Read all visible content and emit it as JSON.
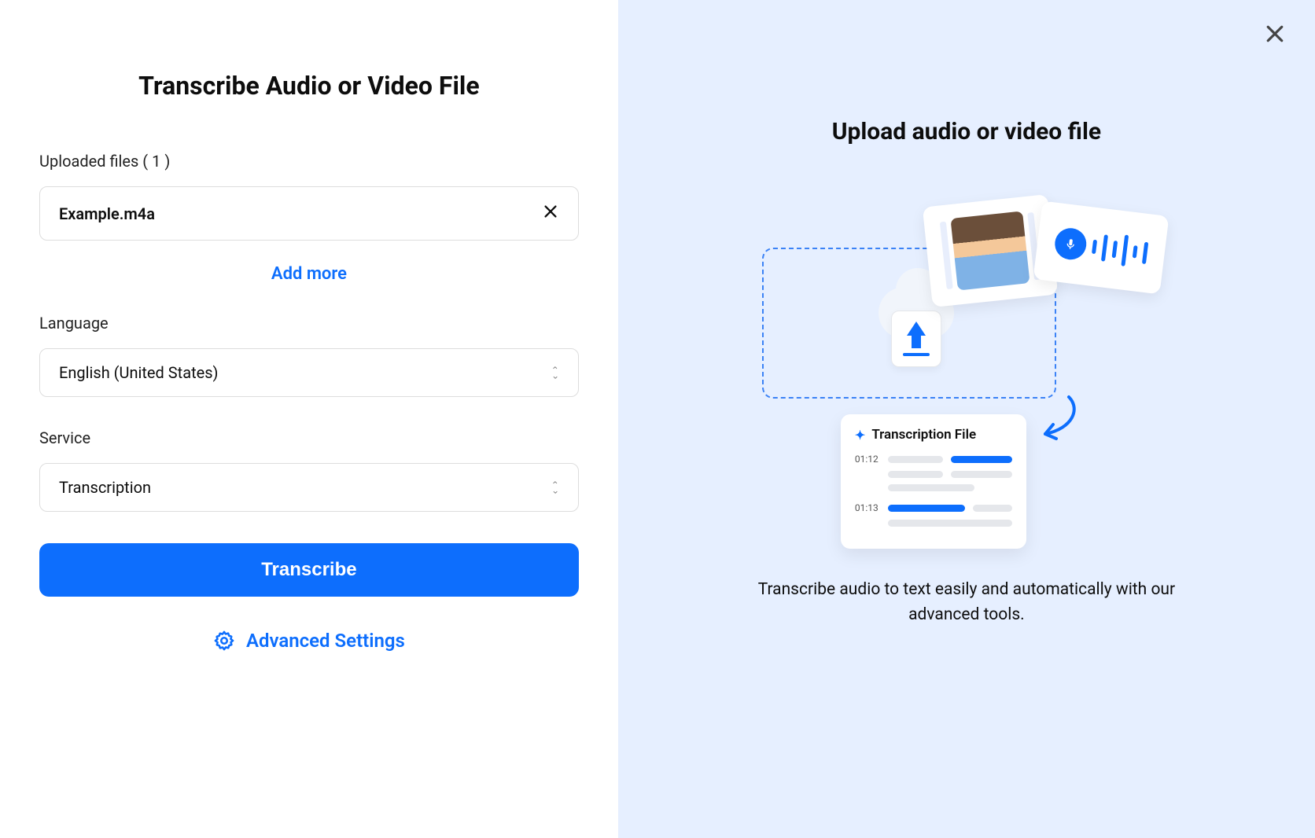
{
  "left": {
    "title": "Transcribe Audio or Video File",
    "uploaded_label": "Uploaded files ( 1 )",
    "file_name": "Example.m4a",
    "add_more": "Add more",
    "language_label": "Language",
    "language_value": "English (United States)",
    "service_label": "Service",
    "service_value": "Transcription",
    "transcribe_btn": "Transcribe",
    "advanced": "Advanced Settings"
  },
  "right": {
    "title": "Upload audio or video file",
    "trans_card_title": "Transcription File",
    "ts1": "01:12",
    "ts2": "01:13",
    "description": "Transcribe audio to text easily and automatically with our advanced tools."
  }
}
